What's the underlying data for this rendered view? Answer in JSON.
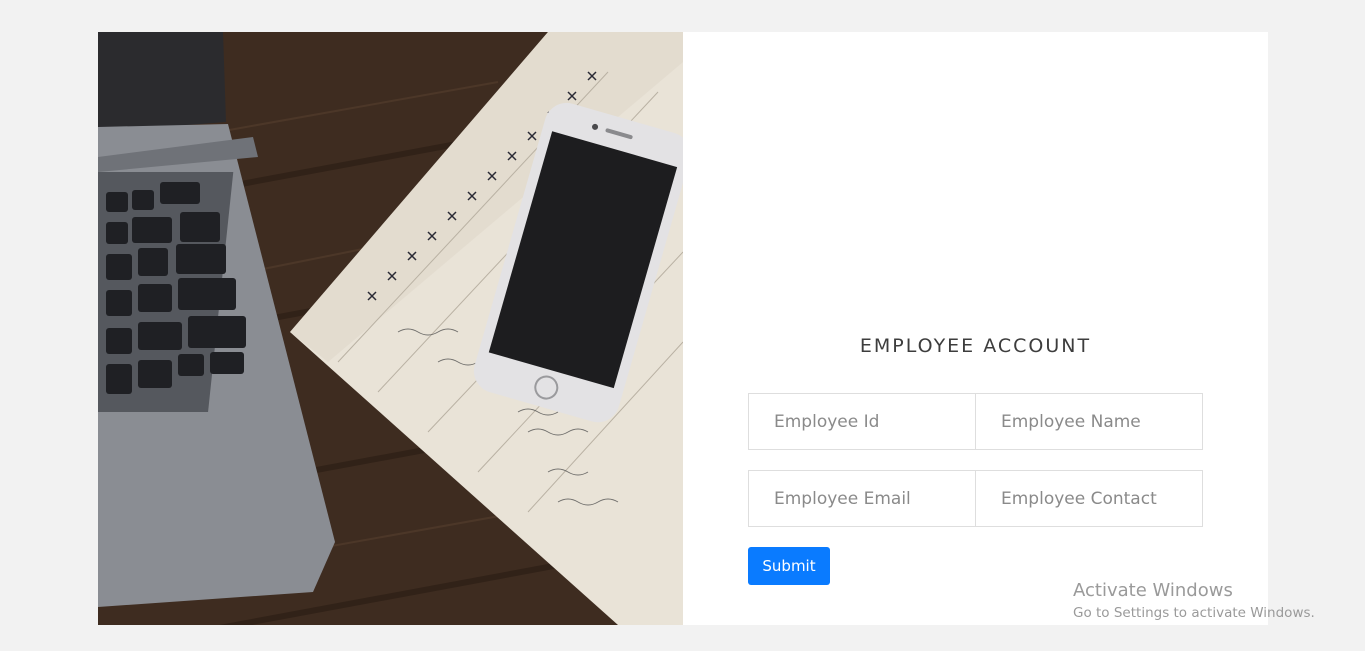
{
  "form": {
    "title": "EMPLOYEE ACCOUNT",
    "fields": {
      "id_placeholder": "Employee Id",
      "name_placeholder": "Employee Name",
      "email_placeholder": "Employee Email",
      "contact_placeholder": "Employee Contact"
    },
    "submit_label": "Submit"
  },
  "watermark": {
    "title": "Activate Windows",
    "subtitle": "Go to Settings to activate Windows."
  },
  "colors": {
    "page_background": "#f2f2f2",
    "accent": "#0a7bff"
  },
  "hero": {
    "icon": "desk-photo-laptop-phone-notebook"
  }
}
